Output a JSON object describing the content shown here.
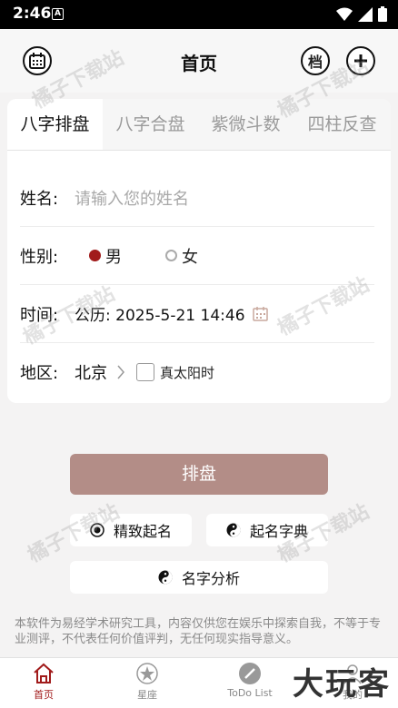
{
  "status": {
    "time": "2:46",
    "sim_label": "A"
  },
  "header": {
    "title": "首页",
    "archive_label": "档"
  },
  "tabs": [
    {
      "label": "八字排盘",
      "active": true
    },
    {
      "label": "八字合盘",
      "active": false
    },
    {
      "label": "紫微斗数",
      "active": false
    },
    {
      "label": "四柱反查",
      "active": false
    }
  ],
  "form": {
    "name_label": "姓名:",
    "name_placeholder": "请输入您的姓名",
    "gender_label": "性别:",
    "gender_male": "男",
    "gender_female": "女",
    "time_label": "时间:",
    "time_value": "公历: 2025-5-21 14:46",
    "region_label": "地区:",
    "region_value": "北京",
    "true_solar_label": "真太阳时"
  },
  "actions": {
    "submit": "排盘",
    "naming": "精致起名",
    "name_dict": "起名字典",
    "name_analysis": "名字分析"
  },
  "disclaimer": "本软件为易经学术研究工具，内容仅供您在娱乐中探索自我，不等于专业测评，不代表任何价值评判，无任何现实指导意义。",
  "nav": [
    {
      "label": "首页",
      "active": true
    },
    {
      "label": "星座",
      "active": false
    },
    {
      "label": "ToDo List",
      "active": false
    },
    {
      "label": "我的",
      "active": false
    }
  ],
  "watermark": "橘子下载站",
  "brand": "大玩客",
  "colors": {
    "accent": "#a11b1b",
    "submit_bg": "#b38d87"
  }
}
